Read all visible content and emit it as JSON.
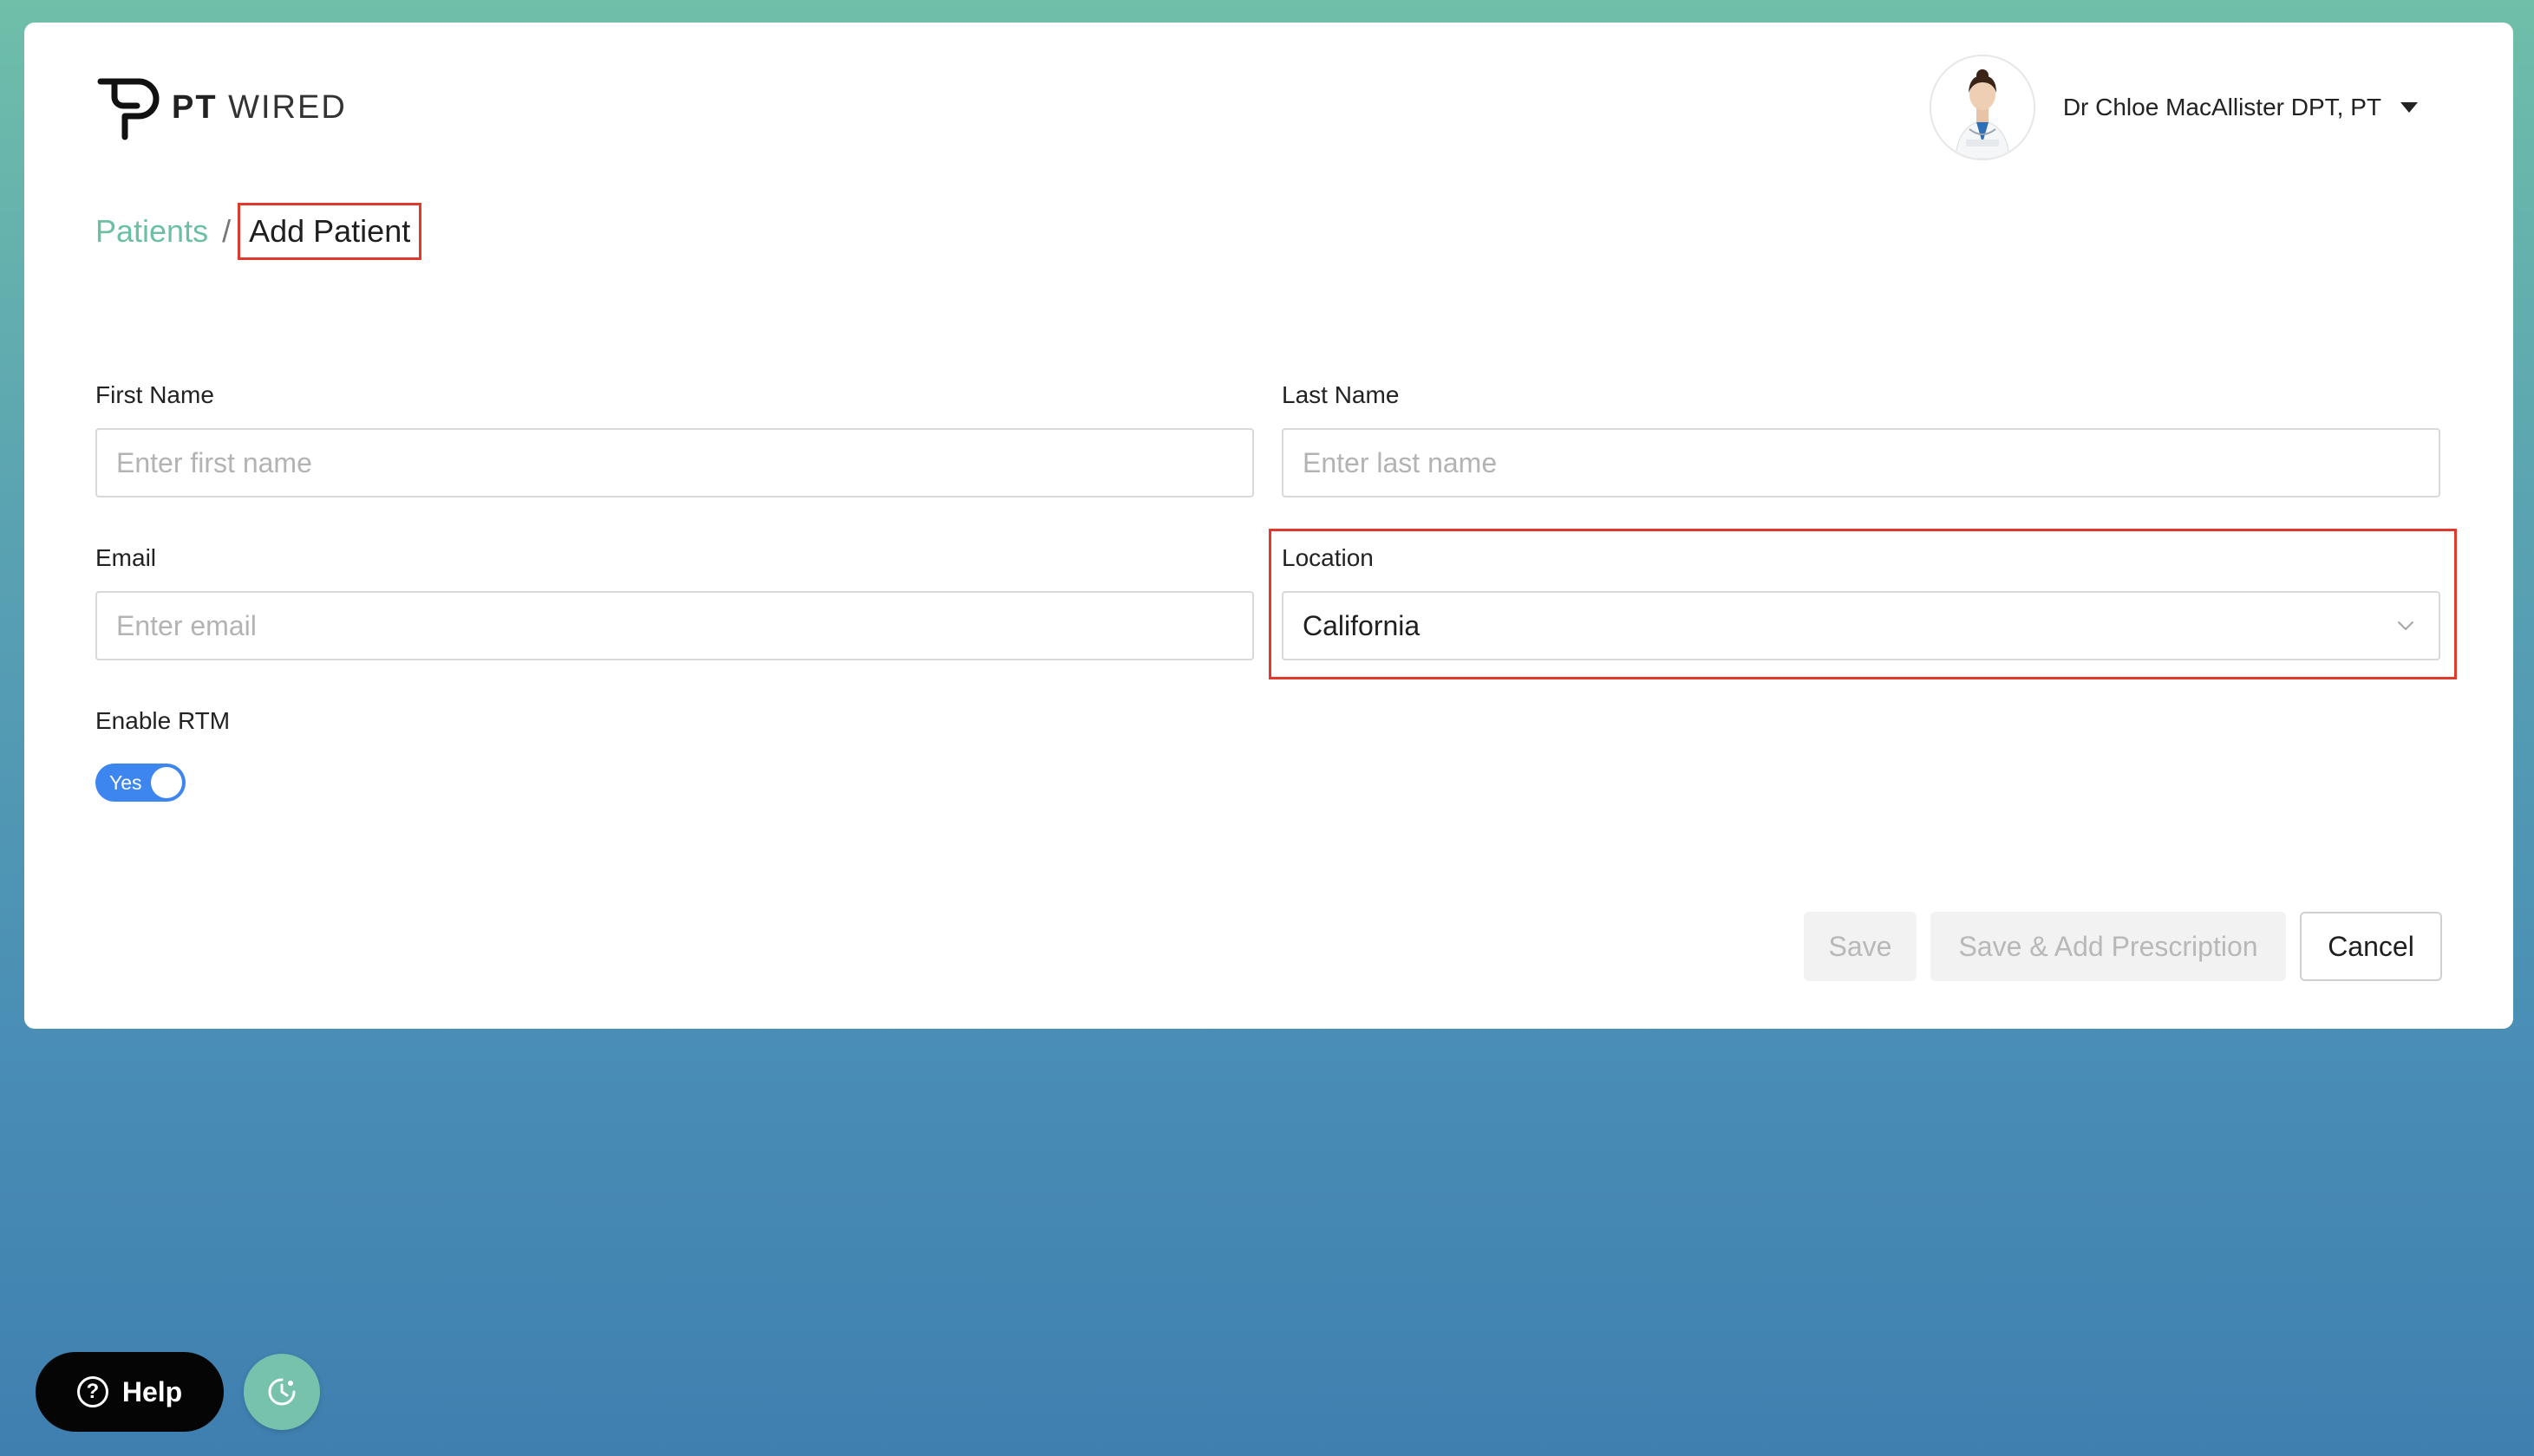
{
  "brand": {
    "name_bold": "PT",
    "name_light": "WIRED"
  },
  "user": {
    "name": "Dr Chloe MacAllister DPT, PT"
  },
  "breadcrumb": {
    "parent": "Patients",
    "separator": "/",
    "current": "Add Patient"
  },
  "form": {
    "first_name": {
      "label": "First Name",
      "placeholder": "Enter first name",
      "value": ""
    },
    "last_name": {
      "label": "Last Name",
      "placeholder": "Enter last name",
      "value": ""
    },
    "email": {
      "label": "Email",
      "placeholder": "Enter email",
      "value": ""
    },
    "location": {
      "label": "Location",
      "value": "California"
    },
    "rtm": {
      "label": "Enable RTM",
      "toggle_text": "Yes",
      "enabled": true
    }
  },
  "actions": {
    "save": "Save",
    "save_add_prescription": "Save & Add Prescription",
    "cancel": "Cancel"
  },
  "help": {
    "label": "Help",
    "q_glyph": "?"
  },
  "colors": {
    "accent_green": "#6cbfa4",
    "toggle_blue": "#3d86f0",
    "highlight_red": "#e03a2f"
  }
}
